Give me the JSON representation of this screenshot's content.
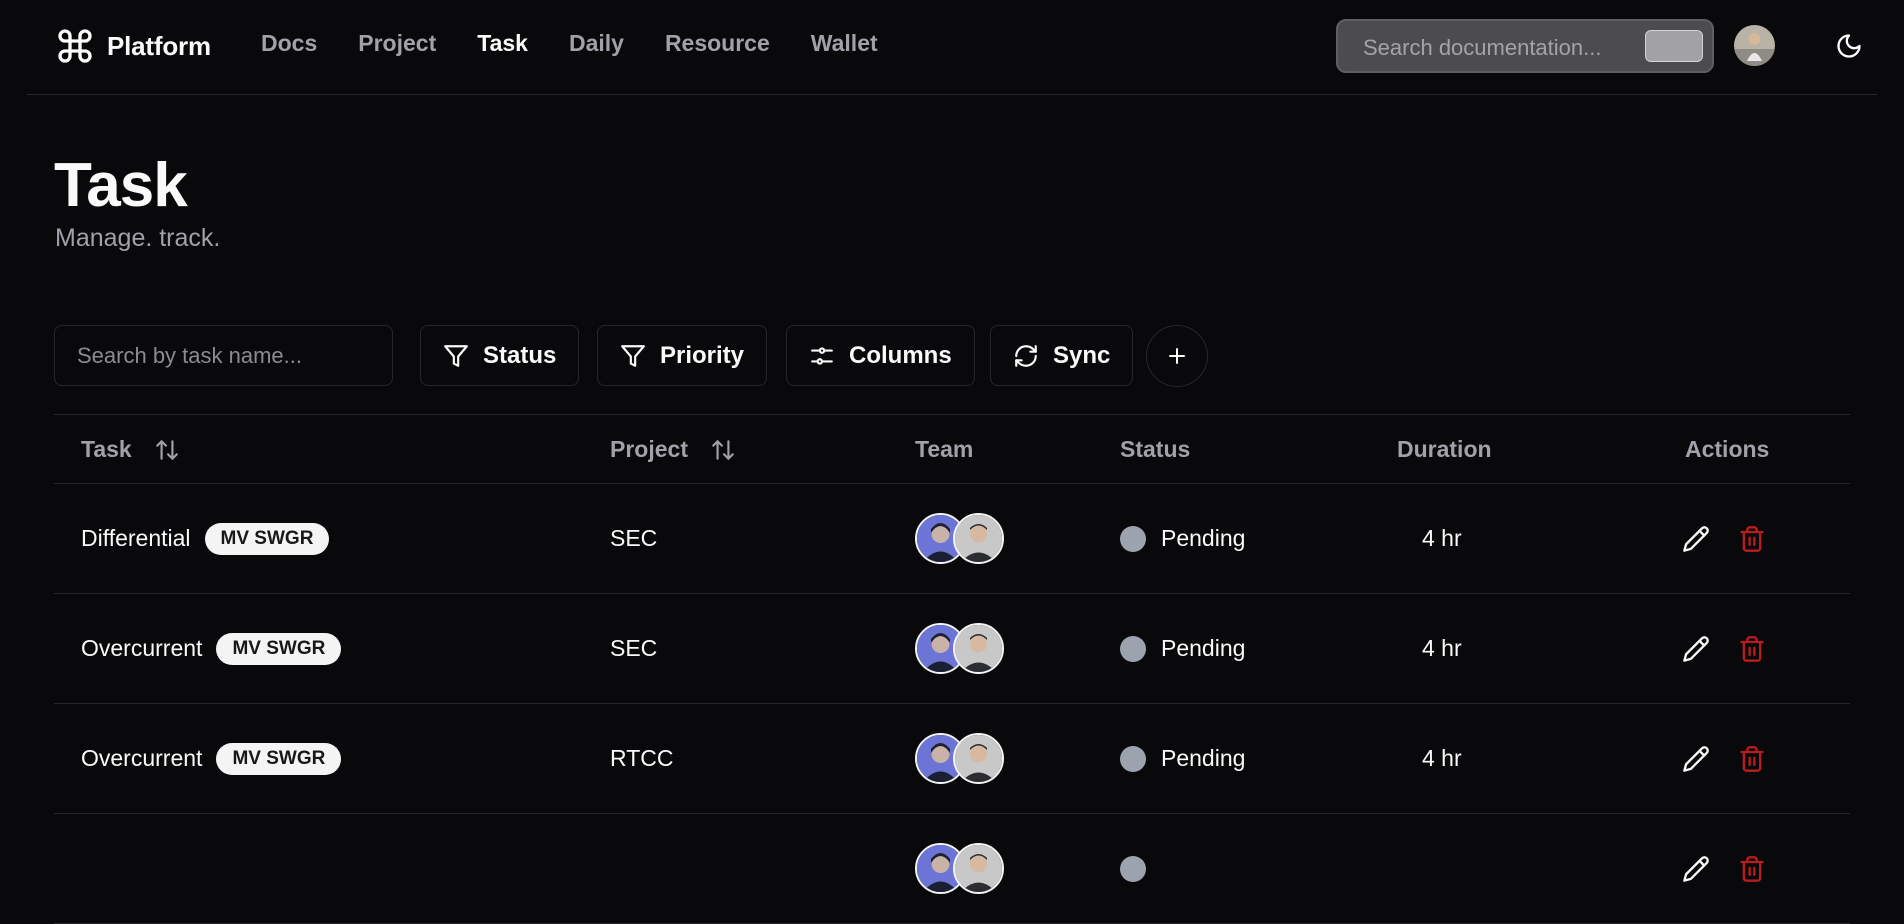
{
  "nav": {
    "brand": "Platform",
    "links": [
      "Docs",
      "Project",
      "Task",
      "Daily",
      "Resource",
      "Wallet"
    ],
    "active": "Task",
    "search_placeholder": "Search documentation..."
  },
  "page": {
    "title": "Task",
    "subtitle": "Manage. track."
  },
  "toolbar": {
    "search_placeholder": "Search by task name...",
    "status_label": "Status",
    "priority_label": "Priority",
    "columns_label": "Columns",
    "sync_label": "Sync"
  },
  "table": {
    "headers": {
      "task": "Task",
      "project": "Project",
      "team": "Team",
      "status": "Status",
      "duration": "Duration",
      "actions": "Actions"
    },
    "rows": [
      {
        "task": "Differential",
        "tag": "MV SWGR",
        "project": "SEC",
        "status": "Pending",
        "duration": "4 hr"
      },
      {
        "task": "Overcurrent",
        "tag": "MV SWGR",
        "project": "SEC",
        "status": "Pending",
        "duration": "4 hr"
      },
      {
        "task": "Overcurrent",
        "tag": "MV SWGR",
        "project": "RTCC",
        "status": "Pending",
        "duration": "4 hr"
      },
      {
        "task": "",
        "tag": "",
        "project": "",
        "status": "",
        "duration": ""
      }
    ]
  },
  "colors": {
    "background": "#09090b",
    "border": "#27272a",
    "muted_text": "#a1a1aa",
    "status_pending": "#9ca3af",
    "delete": "#b91c1c"
  }
}
